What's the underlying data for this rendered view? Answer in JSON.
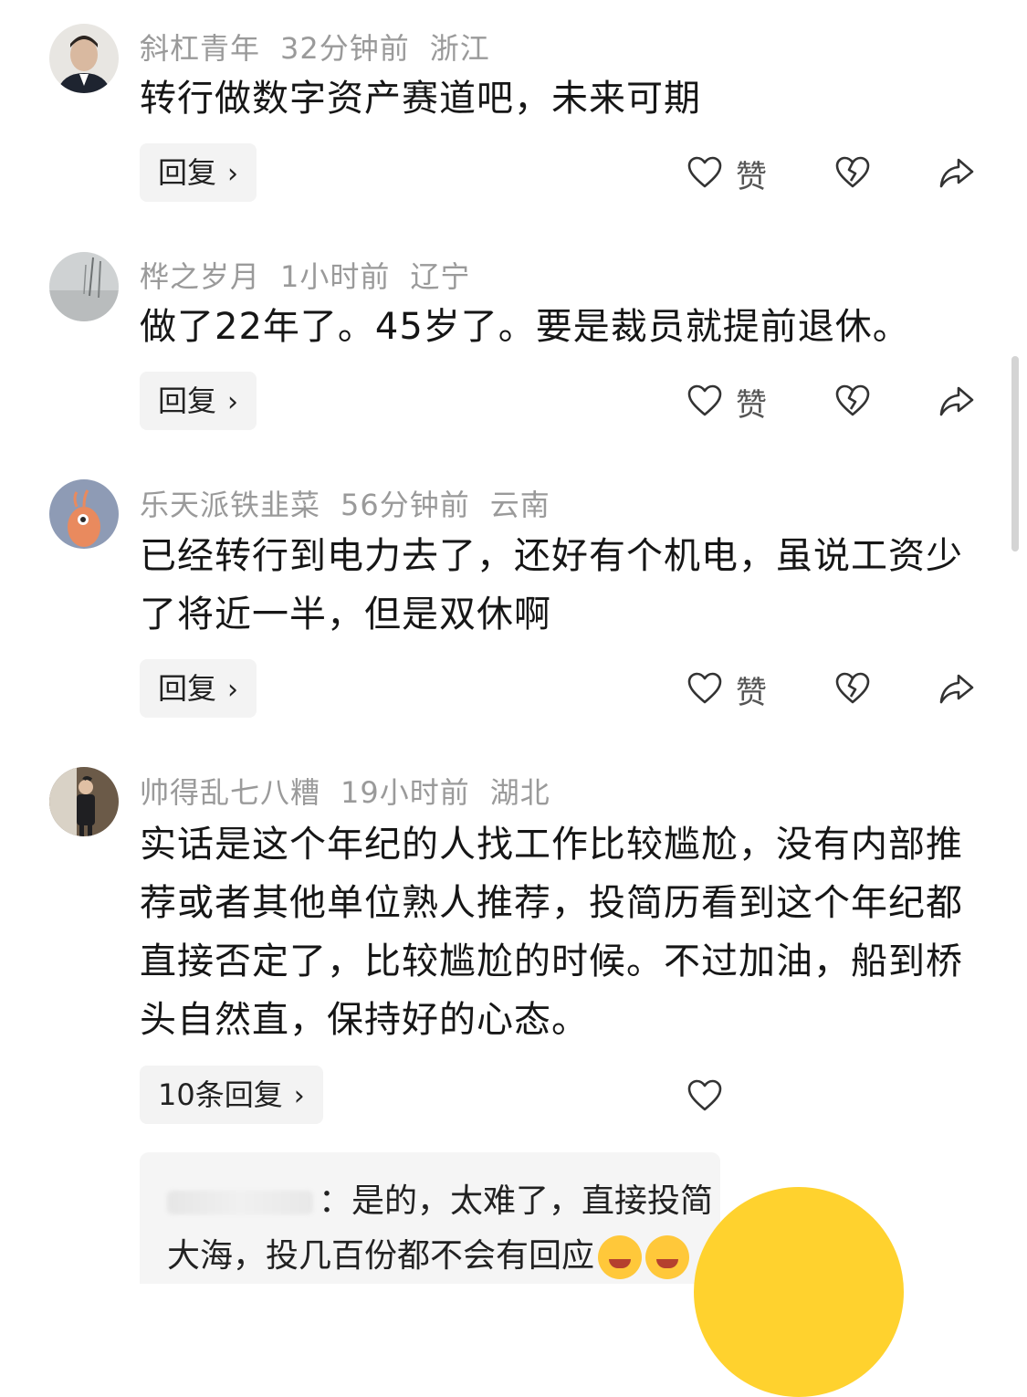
{
  "comments": [
    {
      "username": "斜杠青年",
      "time": "32分钟前",
      "location": "浙江",
      "text": "转行做数字资产赛道吧，未来可期",
      "reply_label": "回复",
      "like_label": "赞"
    },
    {
      "username": "桦之岁月",
      "time": "1小时前",
      "location": "辽宁",
      "text": "做了22年了。45岁了。要是裁员就提前退休。",
      "reply_label": "回复",
      "like_label": "赞"
    },
    {
      "username": "乐天派铁韭菜",
      "time": "56分钟前",
      "location": "云南",
      "text": "已经转行到电力去了，还好有个机电，虽说工资少了将近一半，但是双休啊",
      "reply_label": "回复",
      "like_label": "赞"
    },
    {
      "username": "帅得乱七八糟",
      "time": "19小时前",
      "location": "湖北",
      "text": "实话是这个年纪的人找工作比较尴尬，没有内部推荐或者其他单位熟人推荐，投简历看到这个年纪都直接否定了，比较尴尬的时候。不过加油，船到桥头自然直，保持好的心态。",
      "reply_label": "10条回复"
    }
  ],
  "subreply": {
    "line1": "：是的，太难了，直接投简",
    "line2": "大海，投几百份都不会有回应"
  },
  "icons": {
    "like": "heart-outline-icon",
    "dislike": "broken-heart-icon",
    "share": "share-arrow-icon",
    "chevron": "chevron-right-icon"
  },
  "colors": {
    "meta_gray": "#9a9a9a",
    "reply_bg": "#f3f3f3",
    "emoji_yellow": "#ffd22e"
  }
}
